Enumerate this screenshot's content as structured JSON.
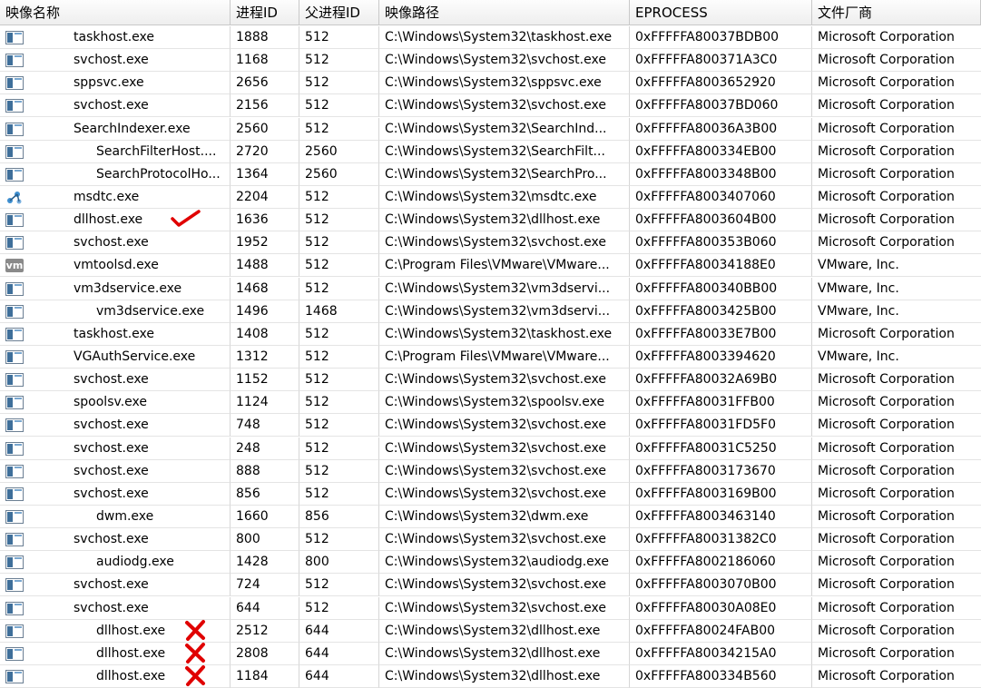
{
  "columns": [
    "映像名称",
    "进程ID",
    "父进程ID",
    "映像路径",
    "EPROCESS",
    "文件厂商"
  ],
  "rows": [
    {
      "name": "taskhost.exe",
      "indent": 1,
      "icon": "window",
      "pid": "1888",
      "ppid": "512",
      "path": "C:\\Windows\\System32\\taskhost.exe",
      "eprocess": "0xFFFFFA80037BDB00",
      "vendor": "Microsoft Corporation"
    },
    {
      "name": "svchost.exe",
      "indent": 1,
      "icon": "window",
      "pid": "1168",
      "ppid": "512",
      "path": "C:\\Windows\\System32\\svchost.exe",
      "eprocess": "0xFFFFFA800371A3C0",
      "vendor": "Microsoft Corporation"
    },
    {
      "name": "sppsvc.exe",
      "indent": 1,
      "icon": "window",
      "pid": "2656",
      "ppid": "512",
      "path": "C:\\Windows\\System32\\sppsvc.exe",
      "eprocess": "0xFFFFFA8003652920",
      "vendor": "Microsoft Corporation"
    },
    {
      "name": "svchost.exe",
      "indent": 1,
      "icon": "window",
      "pid": "2156",
      "ppid": "512",
      "path": "C:\\Windows\\System32\\svchost.exe",
      "eprocess": "0xFFFFFA80037BD060",
      "vendor": "Microsoft Corporation"
    },
    {
      "name": "SearchIndexer.exe",
      "indent": 1,
      "icon": "window",
      "pid": "2560",
      "ppid": "512",
      "path": "C:\\Windows\\System32\\SearchInd...",
      "eprocess": "0xFFFFFA80036A3B00",
      "vendor": "Microsoft Corporation"
    },
    {
      "name": "SearchFilterHost....",
      "indent": 2,
      "icon": "window",
      "pid": "2720",
      "ppid": "2560",
      "path": "C:\\Windows\\System32\\SearchFilt...",
      "eprocess": "0xFFFFFA800334EB00",
      "vendor": "Microsoft Corporation"
    },
    {
      "name": "SearchProtocolHo...",
      "indent": 2,
      "icon": "window",
      "pid": "1364",
      "ppid": "2560",
      "path": "C:\\Windows\\System32\\SearchPro...",
      "eprocess": "0xFFFFFA8003348B00",
      "vendor": "Microsoft Corporation"
    },
    {
      "name": "msdtc.exe",
      "indent": 1,
      "icon": "msdtc",
      "pid": "2204",
      "ppid": "512",
      "path": "C:\\Windows\\System32\\msdtc.exe",
      "eprocess": "0xFFFFFA8003407060",
      "vendor": "Microsoft Corporation"
    },
    {
      "name": "dllhost.exe",
      "indent": 1,
      "icon": "window",
      "pid": "1636",
      "ppid": "512",
      "path": "C:\\Windows\\System32\\dllhost.exe",
      "eprocess": "0xFFFFFA8003604B00",
      "vendor": "Microsoft Corporation",
      "mark": "check"
    },
    {
      "name": "svchost.exe",
      "indent": 1,
      "icon": "window",
      "pid": "1952",
      "ppid": "512",
      "path": "C:\\Windows\\System32\\svchost.exe",
      "eprocess": "0xFFFFFA800353B060",
      "vendor": "Microsoft Corporation"
    },
    {
      "name": "vmtoolsd.exe",
      "indent": 1,
      "icon": "vm",
      "pid": "1488",
      "ppid": "512",
      "path": "C:\\Program Files\\VMware\\VMware...",
      "eprocess": "0xFFFFFA80034188E0",
      "vendor": "VMware, Inc."
    },
    {
      "name": "vm3dservice.exe",
      "indent": 1,
      "icon": "window",
      "pid": "1468",
      "ppid": "512",
      "path": "C:\\Windows\\System32\\vm3dservi...",
      "eprocess": "0xFFFFFA800340BB00",
      "vendor": "VMware, Inc."
    },
    {
      "name": "vm3dservice.exe",
      "indent": 2,
      "icon": "window",
      "pid": "1496",
      "ppid": "1468",
      "path": "C:\\Windows\\System32\\vm3dservi...",
      "eprocess": "0xFFFFFA8003425B00",
      "vendor": "VMware, Inc."
    },
    {
      "name": "taskhost.exe",
      "indent": 1,
      "icon": "window",
      "pid": "1408",
      "ppid": "512",
      "path": "C:\\Windows\\System32\\taskhost.exe",
      "eprocess": "0xFFFFFA80033E7B00",
      "vendor": "Microsoft Corporation"
    },
    {
      "name": "VGAuthService.exe",
      "indent": 1,
      "icon": "window",
      "pid": "1312",
      "ppid": "512",
      "path": "C:\\Program Files\\VMware\\VMware...",
      "eprocess": "0xFFFFFA8003394620",
      "vendor": "VMware, Inc."
    },
    {
      "name": "svchost.exe",
      "indent": 1,
      "icon": "window",
      "pid": "1152",
      "ppid": "512",
      "path": "C:\\Windows\\System32\\svchost.exe",
      "eprocess": "0xFFFFFA80032A69B0",
      "vendor": "Microsoft Corporation"
    },
    {
      "name": "spoolsv.exe",
      "indent": 1,
      "icon": "window",
      "pid": "1124",
      "ppid": "512",
      "path": "C:\\Windows\\System32\\spoolsv.exe",
      "eprocess": "0xFFFFFA80031FFB00",
      "vendor": "Microsoft Corporation"
    },
    {
      "name": "svchost.exe",
      "indent": 1,
      "icon": "window",
      "pid": "748",
      "ppid": "512",
      "path": "C:\\Windows\\System32\\svchost.exe",
      "eprocess": "0xFFFFFA80031FD5F0",
      "vendor": "Microsoft Corporation"
    },
    {
      "name": "svchost.exe",
      "indent": 1,
      "icon": "window",
      "pid": "248",
      "ppid": "512",
      "path": "C:\\Windows\\System32\\svchost.exe",
      "eprocess": "0xFFFFFA80031C5250",
      "vendor": "Microsoft Corporation"
    },
    {
      "name": "svchost.exe",
      "indent": 1,
      "icon": "window",
      "pid": "888",
      "ppid": "512",
      "path": "C:\\Windows\\System32\\svchost.exe",
      "eprocess": "0xFFFFFA8003173670",
      "vendor": "Microsoft Corporation"
    },
    {
      "name": "svchost.exe",
      "indent": 1,
      "icon": "window",
      "pid": "856",
      "ppid": "512",
      "path": "C:\\Windows\\System32\\svchost.exe",
      "eprocess": "0xFFFFFA8003169B00",
      "vendor": "Microsoft Corporation"
    },
    {
      "name": "dwm.exe",
      "indent": 2,
      "icon": "window",
      "pid": "1660",
      "ppid": "856",
      "path": "C:\\Windows\\System32\\dwm.exe",
      "eprocess": "0xFFFFFA8003463140",
      "vendor": "Microsoft Corporation"
    },
    {
      "name": "svchost.exe",
      "indent": 1,
      "icon": "window",
      "pid": "800",
      "ppid": "512",
      "path": "C:\\Windows\\System32\\svchost.exe",
      "eprocess": "0xFFFFFA80031382C0",
      "vendor": "Microsoft Corporation"
    },
    {
      "name": "audiodg.exe",
      "indent": 2,
      "icon": "window",
      "pid": "1428",
      "ppid": "800",
      "path": "C:\\Windows\\System32\\audiodg.exe",
      "eprocess": "0xFFFFFA8002186060",
      "vendor": "Microsoft Corporation"
    },
    {
      "name": "svchost.exe",
      "indent": 1,
      "icon": "window",
      "pid": "724",
      "ppid": "512",
      "path": "C:\\Windows\\System32\\svchost.exe",
      "eprocess": "0xFFFFFA8003070B00",
      "vendor": "Microsoft Corporation"
    },
    {
      "name": "svchost.exe",
      "indent": 1,
      "icon": "window",
      "pid": "644",
      "ppid": "512",
      "path": "C:\\Windows\\System32\\svchost.exe",
      "eprocess": "0xFFFFFA80030A08E0",
      "vendor": "Microsoft Corporation"
    },
    {
      "name": "dllhost.exe",
      "indent": 2,
      "icon": "window",
      "pid": "2512",
      "ppid": "644",
      "path": "C:\\Windows\\System32\\dllhost.exe",
      "eprocess": "0xFFFFFA80024FAB00",
      "vendor": "Microsoft Corporation",
      "mark": "cross"
    },
    {
      "name": "dllhost.exe",
      "indent": 2,
      "icon": "window",
      "pid": "2808",
      "ppid": "644",
      "path": "C:\\Windows\\System32\\dllhost.exe",
      "eprocess": "0xFFFFFA80034215A0",
      "vendor": "Microsoft Corporation",
      "mark": "cross"
    },
    {
      "name": "dllhost.exe",
      "indent": 2,
      "icon": "window",
      "pid": "1184",
      "ppid": "644",
      "path": "C:\\Windows\\System32\\dllhost.exe",
      "eprocess": "0xFFFFFA800334B560",
      "vendor": "Microsoft Corporation",
      "mark": "cross"
    }
  ],
  "colors": {
    "mark": "#e00000",
    "icon_blue": "#3f6f9a"
  }
}
